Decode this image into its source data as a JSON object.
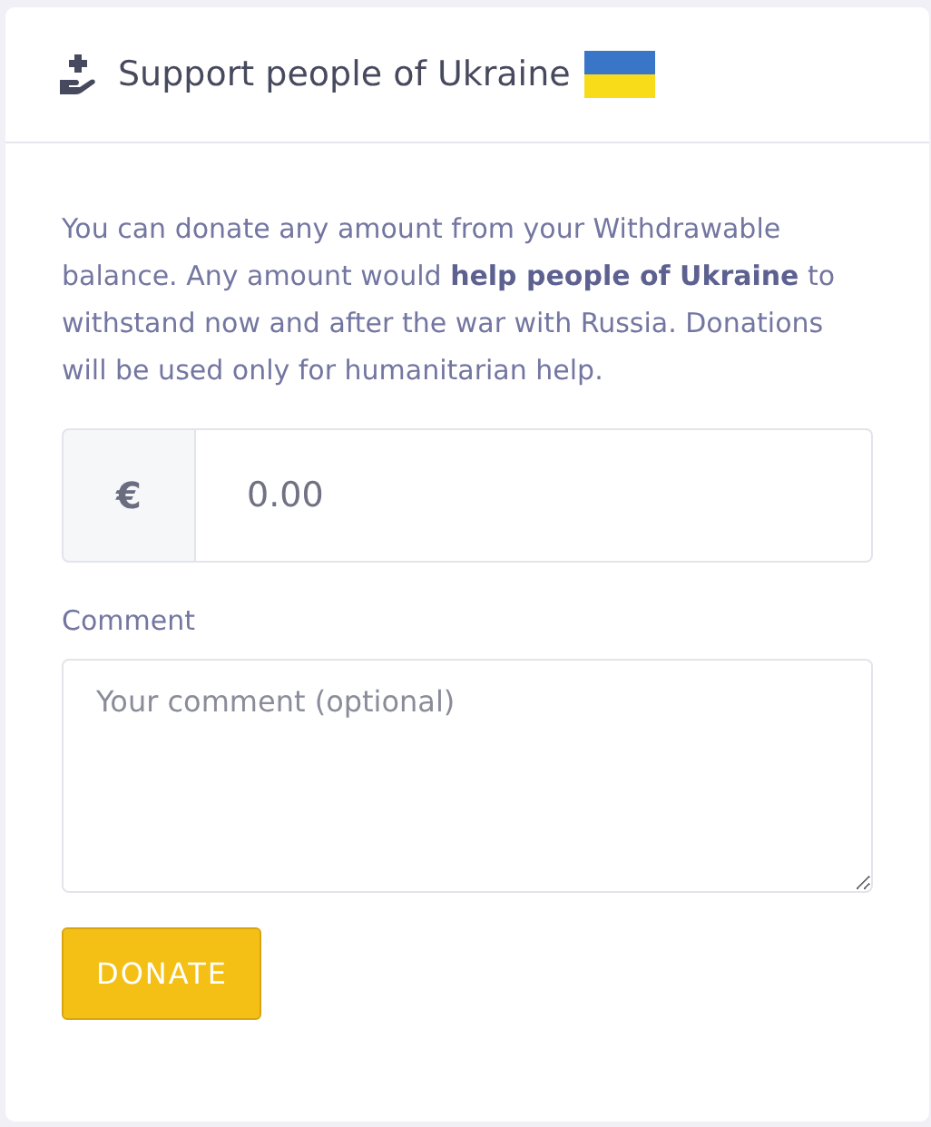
{
  "card": {
    "title": "Support people of Ukraine",
    "description": "You can donate any amount from your Withdrawable balance. Any amount would **help people of Ukraine** to withstand now and after the war with Russia. Donations will be used only for humanitarian help.",
    "amount": {
      "currency": "€",
      "value": "0.00"
    },
    "comment": {
      "label": "Comment",
      "placeholder": "Your comment (optional)"
    },
    "button": "DONATE"
  }
}
